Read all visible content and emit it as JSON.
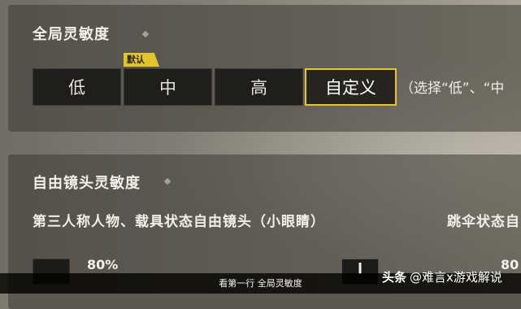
{
  "global_sensitivity": {
    "title": "全局灵敏度",
    "default_tag": "默认",
    "options": [
      "低",
      "中",
      "高",
      "自定义"
    ],
    "selected": "自定义",
    "hint": "（选择“低”、“中"
  },
  "free_look": {
    "title": "自由镜头灵敏度",
    "label_left": "第三人称人物、载具状态自由镜头（小眼睛）",
    "label_right": "跳伞状态自",
    "value_left": "80%",
    "value_right": "80"
  },
  "caption": "看第一行 全局灵敏度",
  "watermark": {
    "brand": "头条",
    "account": "@难言x游戏解说"
  },
  "colors": {
    "accent": "#e8c62a"
  }
}
